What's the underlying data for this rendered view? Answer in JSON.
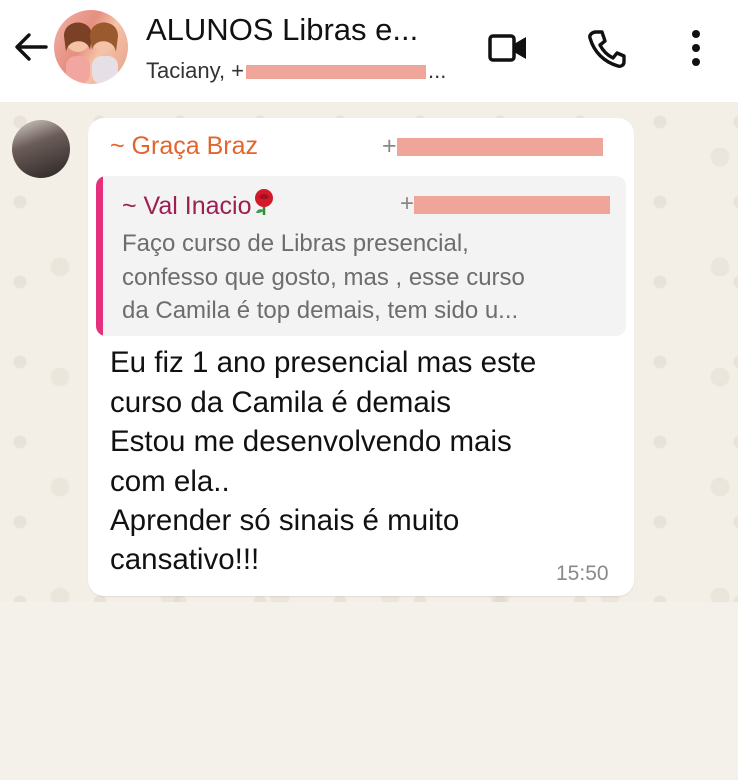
{
  "header": {
    "back_icon": "arrow-left-icon",
    "title": "ALUNOS Libras e...",
    "subtitle_prefix": "Taciany, +",
    "subtitle_suffix": "...",
    "actions": {
      "video_icon": "video-call-icon",
      "call_icon": "phone-icon",
      "more_icon": "more-vertical-icon"
    }
  },
  "message": {
    "sender_name": "~ Graça Braz",
    "sender_phone_prefix": "+",
    "quote": {
      "name": "~ Val Inacio",
      "phone_prefix": "+",
      "lines": [
        "Faço curso de Libras presencial,",
        "confesso que gosto, mas , esse curso",
        "da Camila é top demais, tem sido u..."
      ]
    },
    "body_lines": [
      "Eu fiz 1 ano presencial mas este",
      "curso da Camila é demais",
      "Estou me desenvolvendo mais",
      "com ela..",
      "Aprender só sinais é muito",
      "cansativo!!!"
    ],
    "time": "15:50"
  },
  "colors": {
    "sender_name": "#e2642f",
    "quote_name": "#9c1f4f",
    "quote_bar": "#e5307b",
    "redaction": "#f0a59a"
  }
}
